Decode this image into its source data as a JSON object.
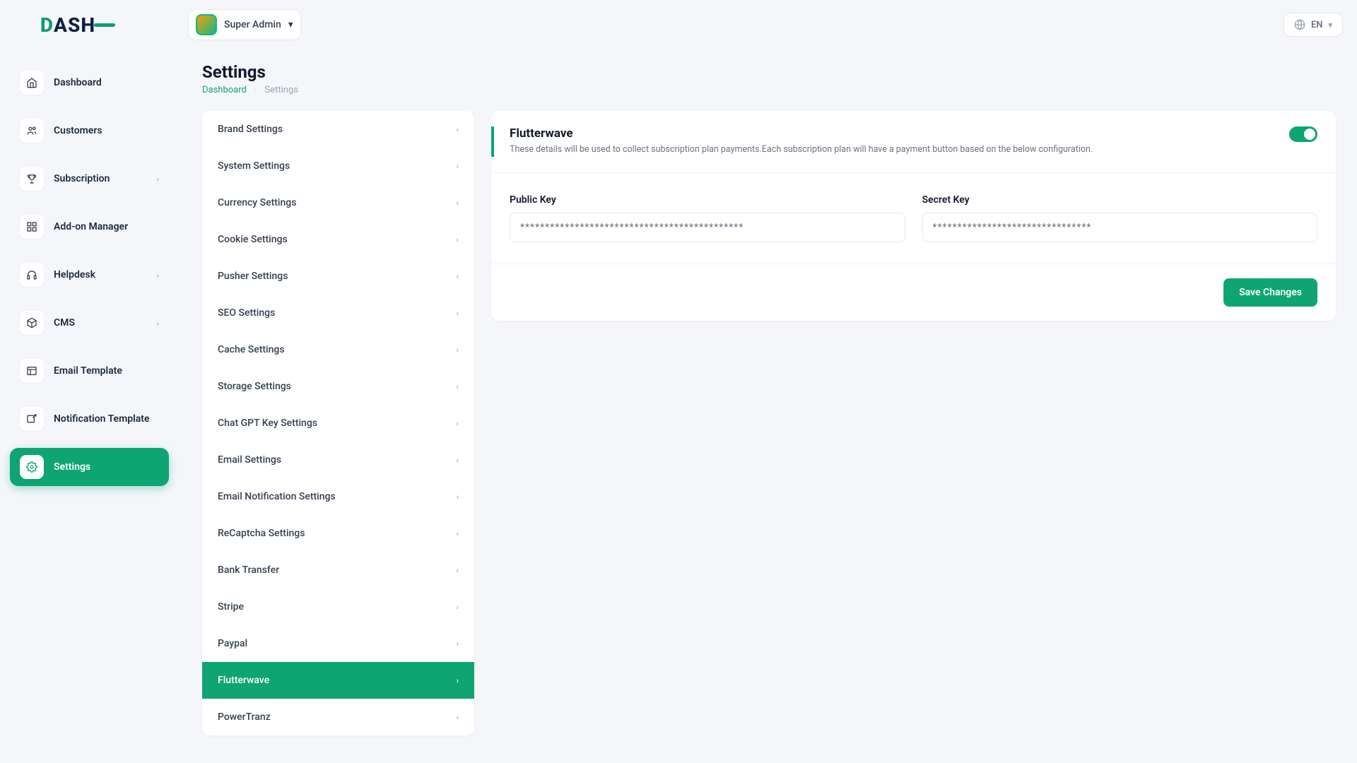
{
  "brand": "DASH",
  "user": {
    "role": "Super Admin"
  },
  "lang": "EN",
  "page": {
    "title": "Settings"
  },
  "breadcrumb": {
    "home": "Dashboard",
    "current": "Settings"
  },
  "nav": [
    {
      "label": "Dashboard",
      "icon": "home"
    },
    {
      "label": "Customers",
      "icon": "users"
    },
    {
      "label": "Subscription",
      "icon": "trophy",
      "chev": true
    },
    {
      "label": "Add-on Manager",
      "icon": "grid"
    },
    {
      "label": "Helpdesk",
      "icon": "headphones",
      "chev": true
    },
    {
      "label": "CMS",
      "icon": "box",
      "chev": true
    },
    {
      "label": "Email Template",
      "icon": "layout"
    },
    {
      "label": "Notification Template",
      "icon": "external"
    },
    {
      "label": "Settings",
      "icon": "gear",
      "active": true
    }
  ],
  "settings_list": [
    "Brand Settings",
    "System Settings",
    "Currency Settings",
    "Cookie Settings",
    "Pusher Settings",
    "SEO Settings",
    "Cache Settings",
    "Storage Settings",
    "Chat GPT Key Settings",
    "Email Settings",
    "Email Notification Settings",
    "ReCaptcha Settings",
    "Bank Transfer",
    "Stripe",
    "Paypal",
    "Flutterwave",
    "PowerTranz"
  ],
  "settings_active_index": 15,
  "panel": {
    "title": "Flutterwave",
    "subtitle": "These details will be used to collect subscription plan payments.Each subscription plan will have a payment button based on the below configuration.",
    "fields": {
      "public_key": {
        "label": "Public Key",
        "value": "*********************************************"
      },
      "secret_key": {
        "label": "Secret Key",
        "value": "********************************"
      }
    },
    "save": "Save Changes"
  }
}
